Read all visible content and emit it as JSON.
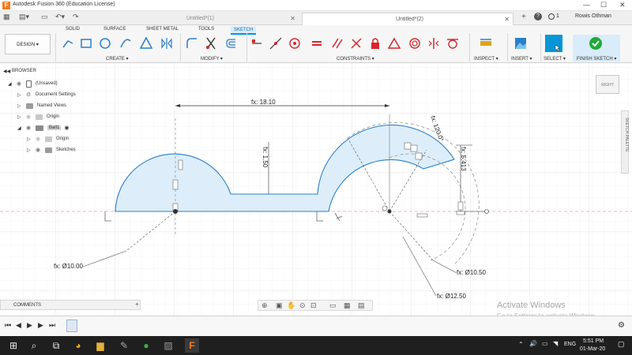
{
  "window": {
    "title": "Autodesk Fusion 360 (Education License)",
    "user": "Rowis Othman",
    "notifications": "1"
  },
  "tabs": [
    {
      "label": "Untitled*(1)"
    },
    {
      "label": "Untitled*(2)"
    }
  ],
  "toolbar": {
    "workspace_tabs": [
      "SOLID",
      "SURFACE",
      "SHEET METAL",
      "TOOLS",
      "SKETCH"
    ],
    "design_label": "DESIGN ▾",
    "groups": [
      "CREATE ▾",
      "MODIFY ▾",
      "CONSTRAINTS ▾",
      "INSPECT ▾",
      "INSERT ▾",
      "SELECT ▾",
      "FINISH SKETCH ▾"
    ]
  },
  "browser": {
    "header": "BROWSER",
    "items": [
      {
        "label": "(Unsaved)"
      },
      {
        "label": "Document Settings"
      },
      {
        "label": "Named Views"
      },
      {
        "label": "Origin"
      },
      {
        "label": "Ball1"
      },
      {
        "label": "Origin"
      },
      {
        "label": "Sketches"
      }
    ]
  },
  "viewcube": {
    "label": "RIGHT"
  },
  "side_palette": {
    "label": "SKETCH PALETTE"
  },
  "dimensions": {
    "width_total": "fx: 18.10",
    "height_slot": "fx: 1.50",
    "angle": "fx: 120.0°",
    "height_right": "fx: 5.413",
    "dia_left": "fx: Ø10.00",
    "dia_inner": "fx: Ø10.50",
    "dia_outer": "fx: Ø12.50"
  },
  "comments": {
    "label": "COMMENTS"
  },
  "watermark": {
    "line1": "Activate Windows",
    "line2": "Go to Settings to activate Windows."
  },
  "taskbar": {
    "lang": "ENG",
    "time": "5:51 PM",
    "date": "01-Mar-20"
  },
  "colors": {
    "accent": "#0696d7",
    "sketch_fill": "#ddeefa",
    "constraint_red": "#d9262c",
    "finish_green": "#1faa3a"
  }
}
